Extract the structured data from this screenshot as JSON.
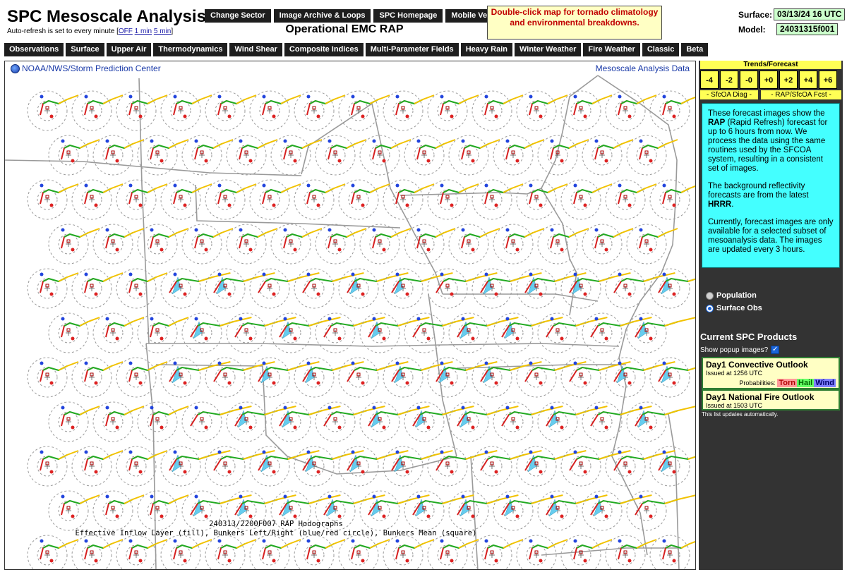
{
  "site": {
    "title": "SPC Mesoscale Analysis",
    "refresh_prefix": "Auto-refresh is set to every minute [",
    "refresh_off": "OFF",
    "refresh_1": "1 min",
    "refresh_5": "5 min",
    "refresh_suffix": "]"
  },
  "top_buttons": [
    "Change Sector",
    "Image Archive & Loops",
    "SPC Homepage",
    "Mobile Version"
  ],
  "model_title": "Operational EMC RAP",
  "notice": "Double-click map for tornado climatology and environmental breakdowns.",
  "surface": {
    "label": "Surface:",
    "value": "03/13/24 16 UTC"
  },
  "model": {
    "label": "Model:",
    "value": "24031315f001"
  },
  "menu": [
    "Observations",
    "Surface",
    "Upper Air",
    "Thermodynamics",
    "Wind Shear",
    "Composite Indices",
    "Multi-Parameter Fields",
    "Heavy Rain",
    "Winter Weather",
    "Fire Weather",
    "Classic",
    "Beta"
  ],
  "map": {
    "credit": "NOAA/NWS/Storm Prediction Center",
    "title": "Mesoscale Analysis Data",
    "caption_line1": "240313/2200F007 RAP Hodographs",
    "caption_line2": "Effective Inflow Layer (fill), Bunkers Left/Right (blue/red circle), Bunkers Mean (square)"
  },
  "trends": {
    "header": "Trends/Forecast",
    "buttons": [
      "-4",
      "-2",
      "-0",
      "+0",
      "+2",
      "+4",
      "+6"
    ],
    "diag_label": "- SfcOA Diag -",
    "fcst_label": "- RAP/SfcOA Fcst -"
  },
  "info": {
    "p1_a": "These forecast images show the ",
    "p1_b": "RAP",
    "p1_c": " (Rapid Refresh) forecast for up to 6 hours from now. We process the data using the same routines used by the SFCOA system, resulting in a consistent set of images.",
    "p2_a": "The background reflectivity forecasts are from the latest ",
    "p2_b": "HRRR",
    "p2_c": ".",
    "p3": "Currently, forecast images are only available for a selected subset of mesoanalysis data. The images are updated every 3 hours."
  },
  "layers": [
    {
      "label": "Population",
      "checked": false
    },
    {
      "label": "Surface Obs",
      "checked": true
    }
  ],
  "products": {
    "title": "Current SPC Products",
    "popup_label": "Show popup images?",
    "popup_checked": true,
    "items": [
      {
        "name": "Day1 Convective Outlook",
        "issued": "Issued at 1256 UTC",
        "prob_label": "Probabilities:",
        "torn": "Torn",
        "hail": "Hail",
        "wind": "Wind"
      },
      {
        "name": "Day1 National Fire Outlook",
        "issued": "Issued at 1503 UTC"
      }
    ],
    "note": "This list updates automatically."
  },
  "colors": {
    "menu_bg": "#1e1e1e",
    "info_bg": "#44ffff",
    "trend_bg": "#ffff55",
    "panel_bg": "#333333",
    "notice_text": "#c00000"
  }
}
